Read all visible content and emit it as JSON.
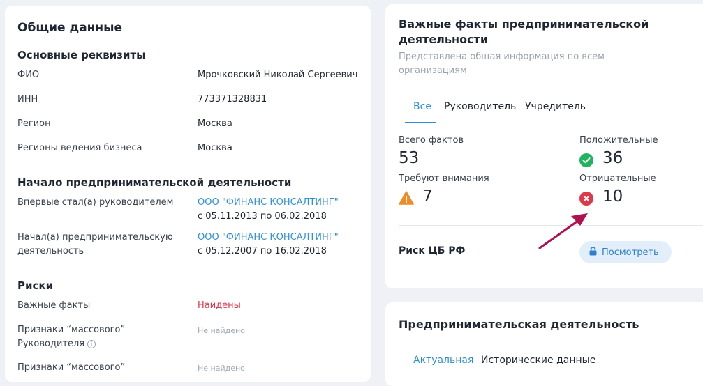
{
  "general": {
    "title": "Общие данные",
    "requisites_title": "Основные реквизиты",
    "rows": [
      {
        "label": "ФИО",
        "value": "Мрочковский Николай Сергеевич"
      },
      {
        "label": "ИНН",
        "value": "773371328831"
      },
      {
        "label": "Регион",
        "value": "Москва"
      },
      {
        "label": "Регионы ведения бизнеса",
        "value": "Москва"
      }
    ],
    "start_title": "Начало предпринимательской деятельности",
    "start_rows": [
      {
        "label1": "Впервые стал(а) руководителем",
        "label2": "",
        "link": "ООО \"ФИНАНС КОНСАЛТИНГ\"",
        "dates": "с 05.11.2013 по 06.02.2018"
      },
      {
        "label1": "Начал(а) предпринимательскую",
        "label2": "деятельность",
        "link": "ООО \"ФИНАНС КОНСАЛТИНГ\"",
        "dates": "с 05.12.2007 по 16.02.2018"
      }
    ],
    "risks_title": "Риски",
    "risks": [
      {
        "label1": "Важные факты",
        "label2": "",
        "value": "Найдены"
      },
      {
        "label1": "Признаки “массового”",
        "label2": "Руководителя",
        "value": "Не найдено"
      },
      {
        "label1": "Признаки “массового”",
        "label2": "",
        "value": "Не найдено"
      }
    ]
  },
  "facts": {
    "title_line1": "Важные факты предпринимательской",
    "title_line2": "деятельности",
    "subtitle_line1": "Представлена общая информация по всем",
    "subtitle_line2": "организациям",
    "tabs": [
      "Все",
      "Руководитель",
      "Учредитель"
    ],
    "active_tab": 0,
    "total_label": "Всего фактов",
    "total_value": "53",
    "positive_label": "Положительные",
    "positive_value": "36",
    "attention_label": "Требуют внимания",
    "attention_value": "7",
    "negative_label": "Отрицательные",
    "negative_value": "10",
    "risk_label": "Риск ЦБ РФ",
    "risk_button": "Посмотреть",
    "colors": {
      "positive": "#22b35e",
      "attention": "#f08a24",
      "negative": "#e0384b",
      "accent": "#2f8fd6",
      "arrow": "#b0124f"
    }
  },
  "activity": {
    "title": "Предпринимательская деятельность",
    "tabs": [
      "Актуальная",
      "Исторические данные"
    ],
    "active_tab": 0
  }
}
